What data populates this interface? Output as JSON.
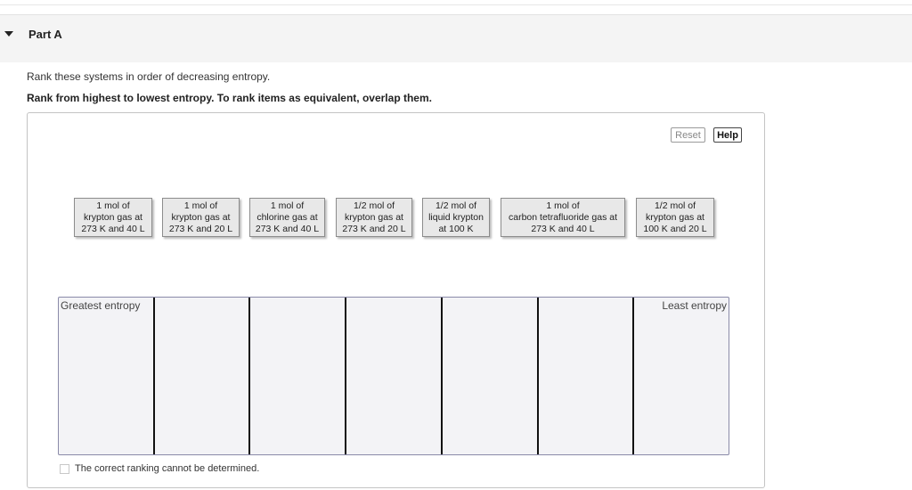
{
  "part": {
    "title": "Part A"
  },
  "question": {
    "prompt": "Rank these systems in order of decreasing entropy.",
    "instructions": "Rank from highest to lowest entropy. To rank items as equivalent, overlap them."
  },
  "controls": {
    "reset_label": "Reset",
    "help_label": "Help"
  },
  "items": [
    {
      "label": "1 mol of\nkrypton gas at\n273 K and 40 L"
    },
    {
      "label": "1 mol of\nkrypton gas at\n273 K and 20 L"
    },
    {
      "label": "1 mol of\nchlorine gas at\n273 K and 40 L"
    },
    {
      "label": "1/2 mol of\nkrypton gas at\n273 K and 20 L"
    },
    {
      "label": "1/2 mol of\nliquid krypton\nat 100 K"
    },
    {
      "label": "1 mol of\ncarbon tetrafluoride gas at\n273 K and 40 L"
    },
    {
      "label": "1/2 mol of\nkrypton gas at\n100 K and 20 L"
    }
  ],
  "ranking": {
    "greatest_label": "Greatest entropy",
    "least_label": "Least entropy",
    "bin_count": 7
  },
  "cannot_determine": {
    "label": "The correct ranking cannot be determined.",
    "checked": false
  }
}
